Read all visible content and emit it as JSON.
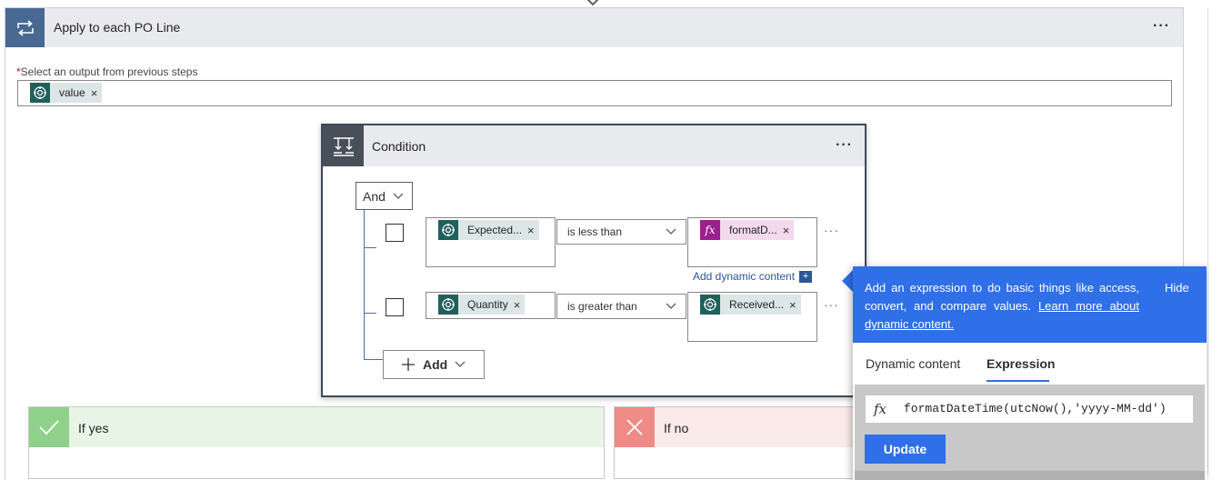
{
  "apply_each": {
    "title": "Apply to each PO Line",
    "more": "···",
    "select_label": "Select an output from previous steps",
    "required_mark": "*",
    "value_token": "value",
    "token_remove": "×"
  },
  "condition": {
    "title": "Condition",
    "more": "···",
    "group_operator": "And",
    "rows": [
      {
        "left_token": "Expected...",
        "operator": "is less than",
        "right_token": "formatD...",
        "more": "···",
        "add_dynamic": "Add dynamic content",
        "add_dynamic_plus": "+"
      },
      {
        "left_token": "Quantity",
        "operator": "is greater than",
        "right_token": "Received...",
        "more": "···"
      }
    ],
    "remove": "×",
    "add_label": "Add"
  },
  "branches": {
    "yes": "If yes",
    "no": "If no"
  },
  "popup": {
    "description": "Add an expression to do basic things like access, convert, and compare values.",
    "link": "Learn more about dynamic content.",
    "hide": "Hide",
    "tabs": [
      "Dynamic content",
      "Expression"
    ],
    "active_tab": "Expression",
    "fx": "fx",
    "expression": "formatDateTime(utcNow(),'yyyy-MM-dd')",
    "update": "Update"
  },
  "colors": {
    "accent_blue": "#2f6fe8",
    "apply_icon": "#486991",
    "condition_icon": "#484f58",
    "token_teal": "#215f5c",
    "fx_purple": "#9c1f8f",
    "yes_green": "#8fd18b",
    "no_red": "#ef8b86"
  }
}
